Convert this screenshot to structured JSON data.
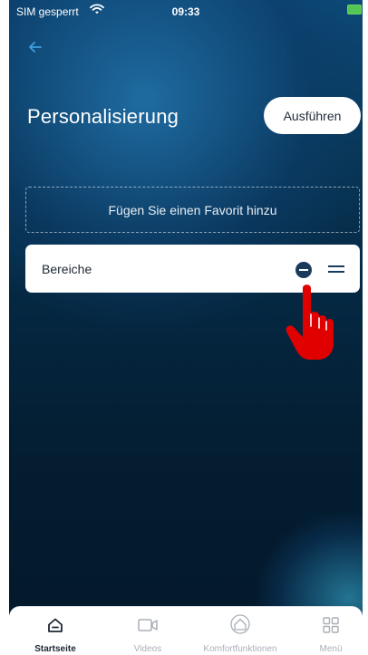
{
  "status_bar": {
    "carrier": "SIM gesperrt",
    "wifi_icon": "wifi-icon",
    "time": "09:33",
    "battery_icon": "battery-charging-icon",
    "battery_color": "#53c653"
  },
  "header": {
    "back_icon": "arrow-left-icon",
    "title": "Personalisierung",
    "run_button": "Ausführen"
  },
  "favorites": {
    "add_placeholder": "Fügen Sie einen Favorit hinzu",
    "items": [
      {
        "label": "Bereiche",
        "remove_icon": "minus-circle-icon",
        "drag_icon": "drag-handle-icon"
      }
    ]
  },
  "overlay": {
    "icon": "pointing-hand-icon",
    "color": "#e00000"
  },
  "tabbar": {
    "tabs": [
      {
        "label": "Startseite",
        "icon": "home-icon",
        "active": true
      },
      {
        "label": "Videos",
        "icon": "video-camera-icon",
        "active": false
      },
      {
        "label": "Komfortfunktionen",
        "icon": "comfort-home-icon",
        "active": false
      },
      {
        "label": "Menü",
        "icon": "grid-menu-icon",
        "active": false
      }
    ]
  },
  "colors": {
    "accent": "#1a3a5c",
    "background_top": "#0c4a78",
    "background_bottom": "#03182a",
    "card": "#ffffff"
  }
}
